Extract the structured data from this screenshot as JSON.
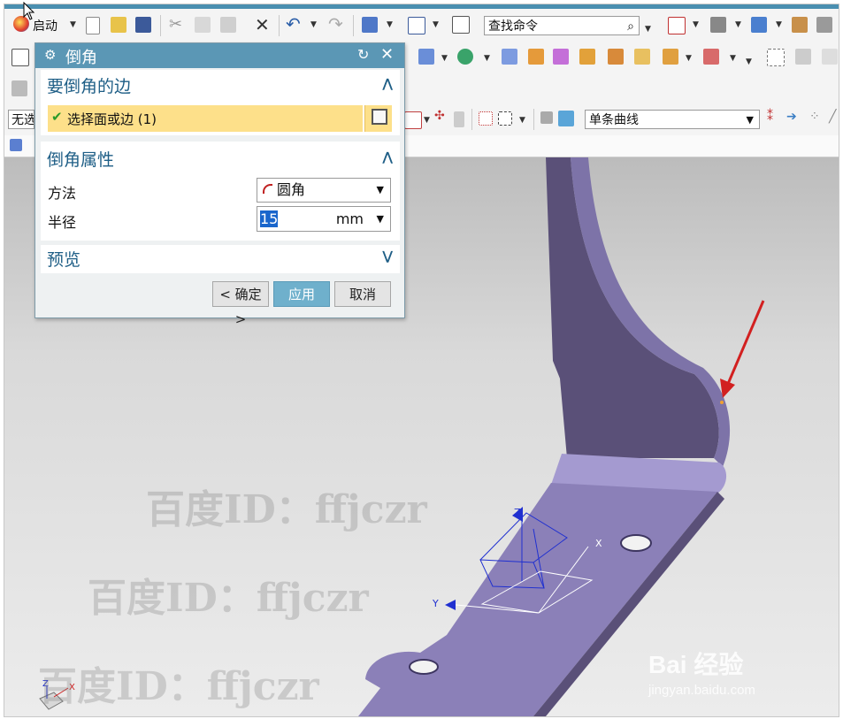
{
  "toolbar": {
    "start_label": "启动",
    "command_search_placeholder": "查找命令",
    "filter_left_text": "无选",
    "curve_rule_value": "单条曲线"
  },
  "dialog": {
    "title": "倒角",
    "section_edge": {
      "header": "要倒角的边",
      "select_label": "选择面或边 (1)"
    },
    "section_props": {
      "header": "倒角属性",
      "method_label": "方法",
      "method_value": "圆角",
      "radius_label": "半径",
      "radius_value": "15",
      "radius_unit": "mm"
    },
    "section_preview": {
      "header": "预览"
    },
    "buttons": {
      "ok": "< 确定 >",
      "apply": "应用",
      "cancel": "取消"
    }
  },
  "viewport": {
    "watermarks": [
      "百度ID：ffjczr",
      "百度ID：ffjczr",
      "百度ID：ffjczr"
    ],
    "logo_text": "Bai 经验",
    "logo_sub": "jingyan.baidu.com",
    "triad_labels": {
      "z": "Z",
      "y": "Y",
      "x": "X"
    }
  },
  "colors": {
    "part_face": "#8b80b8",
    "part_dark": "#5a5078",
    "dialog_header": "#5b97b5",
    "section_text": "#1e5e86",
    "selection_bar": "#fde08a",
    "apply_button": "#6fb0cc",
    "arrow": "#d22020"
  }
}
